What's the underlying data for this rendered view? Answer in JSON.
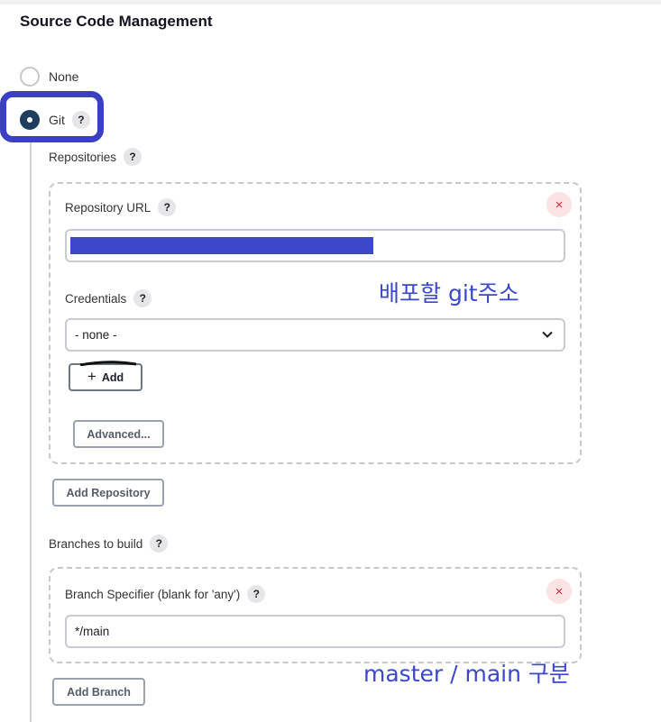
{
  "section_title": "Source Code Management",
  "scm": {
    "options": [
      {
        "label": "None",
        "checked": false
      },
      {
        "label": "Git",
        "checked": true
      }
    ]
  },
  "help_glyph": "?",
  "remove_glyph": "×",
  "repositories": {
    "label": "Repositories",
    "repository_url_label": "Repository URL",
    "repository_url_value": "",
    "credentials_label": "Credentials",
    "credentials_selected": "- none -",
    "add_button": "Add",
    "add_icon": "+",
    "advanced_button": "Advanced...",
    "add_repository_button": "Add Repository"
  },
  "branches": {
    "label": "Branches to build",
    "specifier_label": "Branch Specifier (blank for 'any')",
    "specifier_value": "*/main",
    "add_branch_button": "Add Branch"
  },
  "annotations": {
    "git_url_note": "배포할 git주소",
    "branch_note": "master / main 구분"
  },
  "colors": {
    "annotation": "#3a48c9",
    "radio_checked": "#1f3d5c",
    "remove_icon": "#d2263a"
  }
}
